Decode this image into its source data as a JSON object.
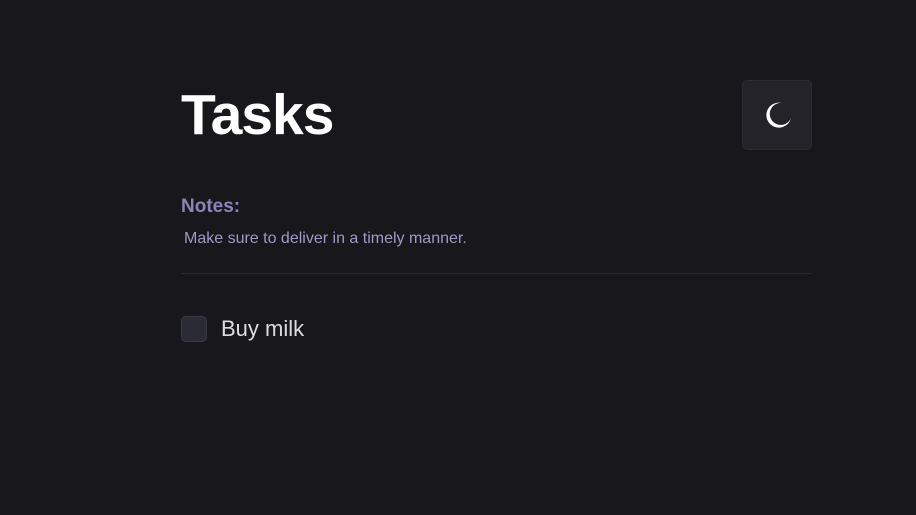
{
  "header": {
    "title": "Tasks",
    "theme_toggle_icon": "moon-icon"
  },
  "notes": {
    "label": "Notes:",
    "text": "Make sure to deliver in a timely manner."
  },
  "tasks": [
    {
      "label": "Buy milk",
      "checked": false
    }
  ],
  "colors": {
    "background": "#18171c",
    "title": "#ffffff",
    "notes_label": "#8b84b8",
    "notes_text": "#9f99c6",
    "task_text": "#dcdce2",
    "button_bg": "#232329"
  }
}
